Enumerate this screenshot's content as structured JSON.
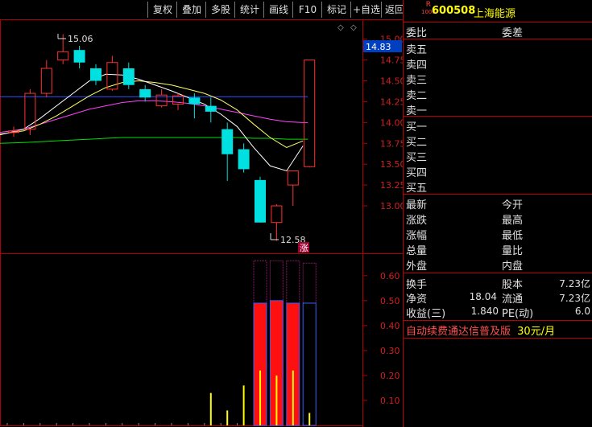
{
  "toolbar": {
    "buttons": [
      "复权",
      "叠加",
      "多股",
      "统计",
      "画线",
      "F10",
      "标记",
      "+自选",
      "返回"
    ]
  },
  "stock": {
    "badge_top": "R",
    "badge_bottom": "1000",
    "code": "600508",
    "name": "上海能源"
  },
  "orderbook": {
    "header_left": "委比",
    "header_right": "委差",
    "sells": [
      "卖五",
      "卖四",
      "卖三",
      "卖二",
      "卖一"
    ],
    "buys": [
      "买一",
      "买二",
      "买三",
      "买四",
      "买五"
    ]
  },
  "quote": {
    "left": [
      "最新",
      "涨跌",
      "涨幅",
      "总量",
      "外盘"
    ],
    "right": [
      "今开",
      "最高",
      "最低",
      "量比",
      "内盘"
    ]
  },
  "fundamentals": {
    "huanshou": "换手",
    "guben": "股本",
    "guben_val": "7.23亿",
    "jingzi": "净资",
    "jingzi_val": "18.04",
    "liutong": "流通",
    "liutong_val": "7.23亿",
    "shouyi": "收益(三)",
    "shouyi_val": "1.840",
    "pe": "PE(动)",
    "pe_val": "6.0"
  },
  "promo": {
    "text": "自动续费通达信普及版",
    "price": "30元/月"
  },
  "price_axis": {
    "labels": [
      "15.00",
      "14.75",
      "14.50",
      "14.25",
      "14.00",
      "13.75",
      "13.50",
      "13.25",
      "13.00"
    ],
    "current": "14.83"
  },
  "volume_axis": {
    "labels": [
      "0.60",
      "0.50",
      "0.40",
      "0.30",
      "0.20",
      "0.10"
    ]
  },
  "annotations": {
    "high": "15.06",
    "low": "12.58",
    "zhang": "涨"
  },
  "colors": {
    "up": "#ff3030",
    "down": "#00e0e0",
    "ma_white": "#ffffff",
    "ma_yellow": "#ffff66",
    "ma_magenta": "#ff40ff",
    "ma_green": "#00e000",
    "ma_blue": "#3050ff"
  },
  "chart_data": {
    "type": "candlestick",
    "candles": [
      {
        "o": 13.88,
        "h": 13.95,
        "l": 13.83,
        "c": 13.9
      },
      {
        "o": 13.92,
        "h": 14.4,
        "l": 13.85,
        "c": 14.35
      },
      {
        "o": 14.35,
        "h": 14.75,
        "l": 14.3,
        "c": 14.65
      },
      {
        "o": 14.75,
        "h": 15.06,
        "l": 14.7,
        "c": 14.85
      },
      {
        "o": 14.87,
        "h": 14.92,
        "l": 14.65,
        "c": 14.72
      },
      {
        "o": 14.65,
        "h": 14.7,
        "l": 14.45,
        "c": 14.5
      },
      {
        "o": 14.4,
        "h": 14.8,
        "l": 14.38,
        "c": 14.72
      },
      {
        "o": 14.65,
        "h": 14.72,
        "l": 14.4,
        "c": 14.45
      },
      {
        "o": 14.4,
        "h": 14.45,
        "l": 14.25,
        "c": 14.3
      },
      {
        "o": 14.2,
        "h": 14.4,
        "l": 14.18,
        "c": 14.33
      },
      {
        "o": 14.22,
        "h": 14.35,
        "l": 14.15,
        "c": 14.32
      },
      {
        "o": 14.3,
        "h": 14.35,
        "l": 14.05,
        "c": 14.22
      },
      {
        "o": 14.2,
        "h": 14.3,
        "l": 14.0,
        "c": 14.13
      },
      {
        "o": 13.92,
        "h": 14.0,
        "l": 13.3,
        "c": 13.62
      },
      {
        "o": 13.68,
        "h": 13.75,
        "l": 13.4,
        "c": 13.44
      },
      {
        "o": 13.31,
        "h": 13.35,
        "l": 12.8,
        "c": 12.8
      },
      {
        "o": 12.8,
        "h": 13.02,
        "l": 12.58,
        "c": 13.0
      },
      {
        "o": 13.25,
        "h": 13.42,
        "l": 13.0,
        "c": 13.42
      },
      {
        "o": 13.47,
        "h": 14.75,
        "l": 13.46,
        "c": 14.75
      }
    ],
    "ma_white": [
      13.85,
      13.92,
      14.05,
      14.2,
      14.35,
      14.5,
      14.58,
      14.57,
      14.52,
      14.45,
      14.38,
      14.3,
      14.22,
      14.1,
      13.95,
      13.7,
      13.48,
      13.42,
      13.72
    ],
    "ma_yellow": [
      13.86,
      13.9,
      13.98,
      14.08,
      14.2,
      14.32,
      14.42,
      14.48,
      14.5,
      14.48,
      14.45,
      14.4,
      14.35,
      14.27,
      14.15,
      13.98,
      13.82,
      13.7,
      13.78
    ],
    "ma_magenta": [
      13.88,
      13.92,
      13.98,
      14.04,
      14.1,
      14.16,
      14.2,
      14.24,
      14.26,
      14.26,
      14.25,
      14.23,
      14.2,
      14.16,
      14.12,
      14.08,
      14.04,
      14.01,
      14.0
    ],
    "ma_green": [
      13.75,
      13.76,
      13.77,
      13.78,
      13.79,
      13.8,
      13.81,
      13.82,
      13.82,
      13.82,
      13.82,
      13.82,
      13.82,
      13.82,
      13.82,
      13.81,
      13.81,
      13.8,
      13.8
    ],
    "ma_blue": [
      14.31,
      14.31,
      14.31,
      14.31,
      14.31,
      14.31,
      14.31,
      14.31,
      14.31,
      14.31,
      14.31,
      14.31,
      14.31,
      14.31,
      14.31,
      14.31,
      14.31,
      14.31,
      14.31
    ],
    "price_range": [
      12.45,
      15.2
    ],
    "volume": [
      0.01,
      0.01,
      0.01,
      0.01,
      0.01,
      0.01,
      0.01,
      0.01,
      0.01,
      0.01,
      0.01,
      0.01,
      0.13,
      0.06,
      0.16,
      0.22,
      0.2,
      0.05,
      0.5
    ],
    "volume_bars": [
      {
        "index": 15,
        "up": true,
        "value": 0.49,
        "cap": 0.66
      },
      {
        "index": 16,
        "up": true,
        "value": 0.5,
        "cap": 0.66
      },
      {
        "index": 17,
        "up": true,
        "value": 0.49,
        "cap": 0.66
      },
      {
        "index": 18,
        "up": false,
        "value": 0.49,
        "cap": 0.65
      }
    ],
    "volume_range": [
      0,
      0.68
    ]
  }
}
